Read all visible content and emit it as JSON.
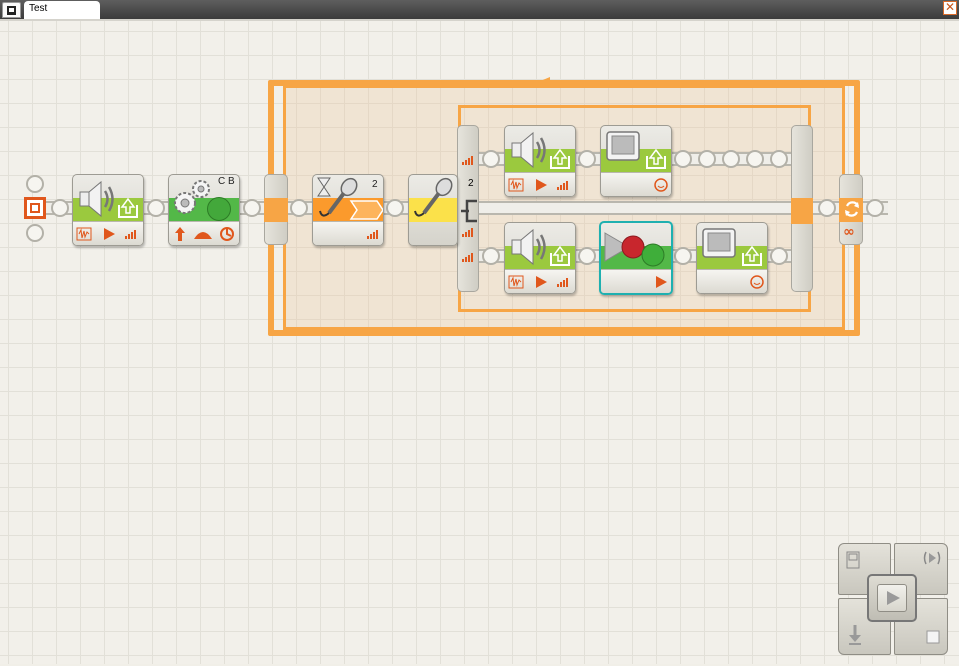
{
  "window": {
    "tab_title": "Test",
    "close_glyph": "✕",
    "app_icon": "nxt-program-icon"
  },
  "colors": {
    "loop_orange": "#f7a545",
    "sound_green": "#9bc93e",
    "motor_green": "#53b848",
    "wait_orange": "#fb9a2c",
    "sensor_yellow": "#fbe14a",
    "selection_teal": "#1fb0b0",
    "config_orange": "#e0571c"
  },
  "blocks": {
    "sound_1": {
      "icon": "speaker-icon"
    },
    "motor": {
      "ports": "C B",
      "icon": "gears-icon"
    },
    "wait_sound": {
      "port": "2",
      "icon": "microphone-hourglass-icon"
    },
    "switch_sensor": {
      "port": "2",
      "icon": "microphone-icon"
    },
    "sound_upper": {
      "icon": "speaker-icon"
    },
    "display_upper": {
      "icon": "display-icon"
    },
    "sound_lower": {
      "icon": "speaker-icon"
    },
    "record_play": {
      "icon": "record-play-icon"
    },
    "display_lower": {
      "icon": "display-icon"
    }
  },
  "loop": {
    "icons": [
      "loop-arrows-icon",
      "infinity-icon"
    ],
    "infinity": "∞"
  },
  "navigation": {
    "buttons": [
      "controller-icon",
      "upload-play-selected-icon",
      "play-icon",
      "download-icon",
      "stop-icon"
    ]
  }
}
